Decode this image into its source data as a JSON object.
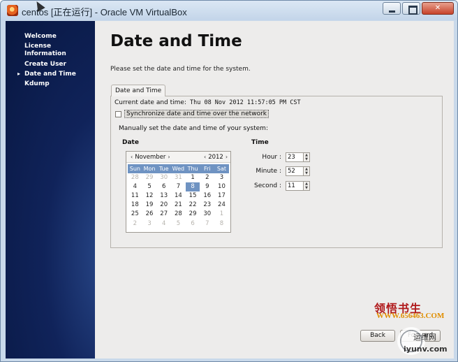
{
  "window": {
    "title": "centos [正在运行] - Oracle VM VirtualBox",
    "min_glyph": "",
    "max_glyph": "",
    "close_glyph": "✕"
  },
  "sidebar": {
    "items": [
      {
        "label": "Welcome"
      },
      {
        "label": "License Information"
      },
      {
        "label": "Create User"
      },
      {
        "label": "Date and Time",
        "current": true
      },
      {
        "label": "Kdump"
      }
    ],
    "current_marker": "▸"
  },
  "page": {
    "title": "Date and Time",
    "intro": "Please set the date and time for the system.",
    "tab_label": "Date and Time",
    "current_label": "Current date and time:",
    "current_value": "Thu 08 Nov 2012 11:57:05 PM CST",
    "sync_label": "Synchronize date and time over the network",
    "sync_checked": false,
    "manual_label": "Manually set the date and time of your system:",
    "date_label": "Date",
    "time_label": "Time"
  },
  "calendar": {
    "prev_month": "‹",
    "next_month": "›",
    "prev_year": "‹",
    "next_year": "›",
    "month": "November",
    "year": "2012",
    "weekdays": [
      "Sun",
      "Mon",
      "Tue",
      "Wed",
      "Thu",
      "Fri",
      "Sat"
    ],
    "weeks": [
      [
        {
          "d": "28",
          "m": true
        },
        {
          "d": "29",
          "m": true
        },
        {
          "d": "30",
          "m": true
        },
        {
          "d": "31",
          "m": true
        },
        {
          "d": "1"
        },
        {
          "d": "2"
        },
        {
          "d": "3"
        }
      ],
      [
        {
          "d": "4"
        },
        {
          "d": "5"
        },
        {
          "d": "6"
        },
        {
          "d": "7"
        },
        {
          "d": "8",
          "s": true
        },
        {
          "d": "9"
        },
        {
          "d": "10"
        }
      ],
      [
        {
          "d": "11"
        },
        {
          "d": "12"
        },
        {
          "d": "13"
        },
        {
          "d": "14"
        },
        {
          "d": "15"
        },
        {
          "d": "16"
        },
        {
          "d": "17"
        }
      ],
      [
        {
          "d": "18"
        },
        {
          "d": "19"
        },
        {
          "d": "20"
        },
        {
          "d": "21"
        },
        {
          "d": "22"
        },
        {
          "d": "23"
        },
        {
          "d": "24"
        }
      ],
      [
        {
          "d": "25"
        },
        {
          "d": "26"
        },
        {
          "d": "27"
        },
        {
          "d": "28"
        },
        {
          "d": "29"
        },
        {
          "d": "30"
        },
        {
          "d": "1",
          "m": true
        }
      ],
      [
        {
          "d": "2",
          "m": true
        },
        {
          "d": "3",
          "m": true
        },
        {
          "d": "4",
          "m": true
        },
        {
          "d": "5",
          "m": true
        },
        {
          "d": "6",
          "m": true
        },
        {
          "d": "7",
          "m": true
        },
        {
          "d": "8",
          "m": true
        }
      ]
    ]
  },
  "time": {
    "hour_label": "Hour :",
    "hour_value": "23",
    "minute_label": "Minute :",
    "minute_value": "52",
    "second_label": "Second :",
    "second_value": "11",
    "spin_up": "▲",
    "spin_down": "▼"
  },
  "watermark": {
    "cn": "领悟书生",
    "url": "WWW.656463.COM"
  },
  "footer": {
    "back_label": "Back",
    "forward_label": "Forward",
    "logo_text_1": "运维网",
    "logo_text_2": "iyunv.com"
  },
  "colors": {
    "selection": "#6f93c2",
    "sidebar_bg": "#0b1c4e"
  }
}
